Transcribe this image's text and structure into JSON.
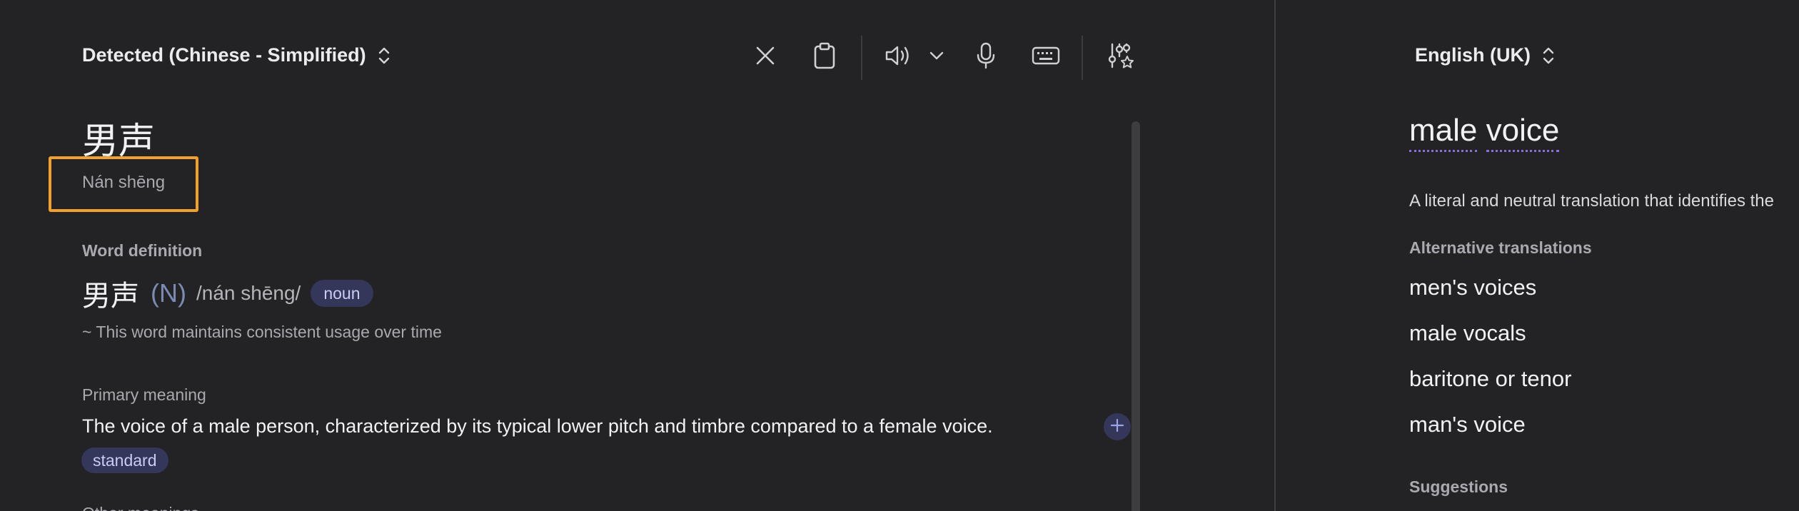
{
  "source": {
    "language_label": "Detected (Chinese - Simplified)",
    "word": "男声",
    "pinyin": "Nán shēng",
    "definition_section_title": "Word definition",
    "definition": {
      "word": "男声",
      "part_of_speech_abbr": "(N)",
      "pronunciation": "/nán shēng/",
      "pos_badge": "noun",
      "usage_note": "~ This word maintains consistent usage over time"
    },
    "primary_meaning": {
      "label": "Primary meaning",
      "text": "The voice of a male person, characterized by its typical lower pitch and timbre compared to a female voice.",
      "tag": "standard"
    },
    "other_meanings_label": "Other meanings"
  },
  "toolbar": {
    "icons": [
      "close-icon",
      "clipboard-icon",
      "speaker-icon",
      "chevron-down-icon",
      "microphone-icon",
      "keyboard-icon",
      "sliders-star-icon"
    ]
  },
  "target": {
    "language_label": "English (UK)",
    "translation_words": [
      "male",
      "voice"
    ],
    "description": "A literal and neutral translation that identifies the",
    "alternatives_title": "Alternative translations",
    "alternatives": [
      "men's voices",
      "male vocals",
      "baritone or tenor",
      "man's voice"
    ],
    "suggestions_title": "Suggestions"
  },
  "colors": {
    "background": "#232325",
    "highlight_border": "#f0a12e",
    "badge_bg": "#34365a",
    "underline_accent": "#8b6fd6"
  }
}
